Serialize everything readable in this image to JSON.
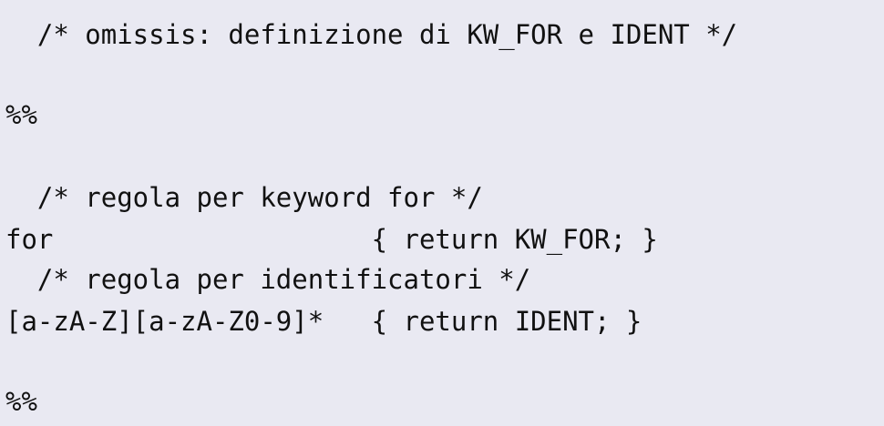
{
  "code_lines": [
    "  /* omissis: definizione di KW_FOR e IDENT */",
    "",
    "%%",
    "",
    "  /* regola per keyword for */",
    "for                    { return KW_FOR; }",
    "  /* regola per identificatori */",
    "[a-zA-Z][a-zA-Z0-9]*   { return IDENT; }",
    "",
    "%%"
  ]
}
